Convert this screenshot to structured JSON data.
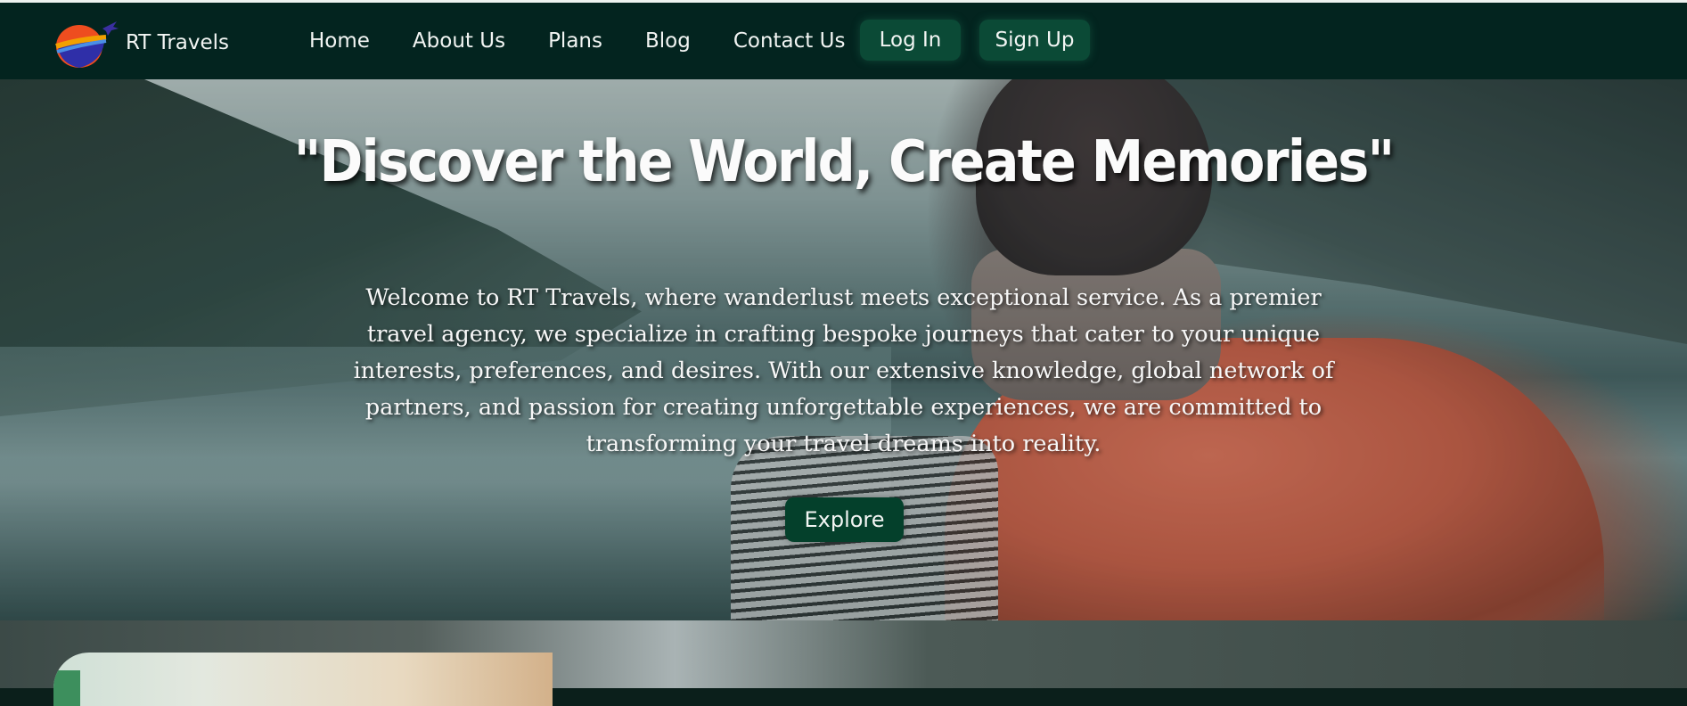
{
  "brand": {
    "name": "RT Travels",
    "logo_icon": "travel-globe-plane-icon"
  },
  "nav": {
    "links": [
      "Home",
      "About Us",
      "Plans",
      "Blog",
      "Contact Us"
    ],
    "login_label": "Log In",
    "signup_label": "Sign Up"
  },
  "hero": {
    "title": "\"Discover the World, Create Memories\"",
    "description": "Welcome to RT Travels, where wanderlust meets exceptional service. As a premier travel agency, we specialize in crafting bespoke journeys that cater to your unique interests, preferences, and desires. With our extensive knowledge, global network of partners, and passion for creating unforgettable experiences, we are committed to transforming your travel dreams into reality.",
    "cta_label": "Explore"
  },
  "colors": {
    "navbar_bg": "#03241f",
    "button_bg": "#0b4a36",
    "text_light": "#f2f5f3"
  }
}
